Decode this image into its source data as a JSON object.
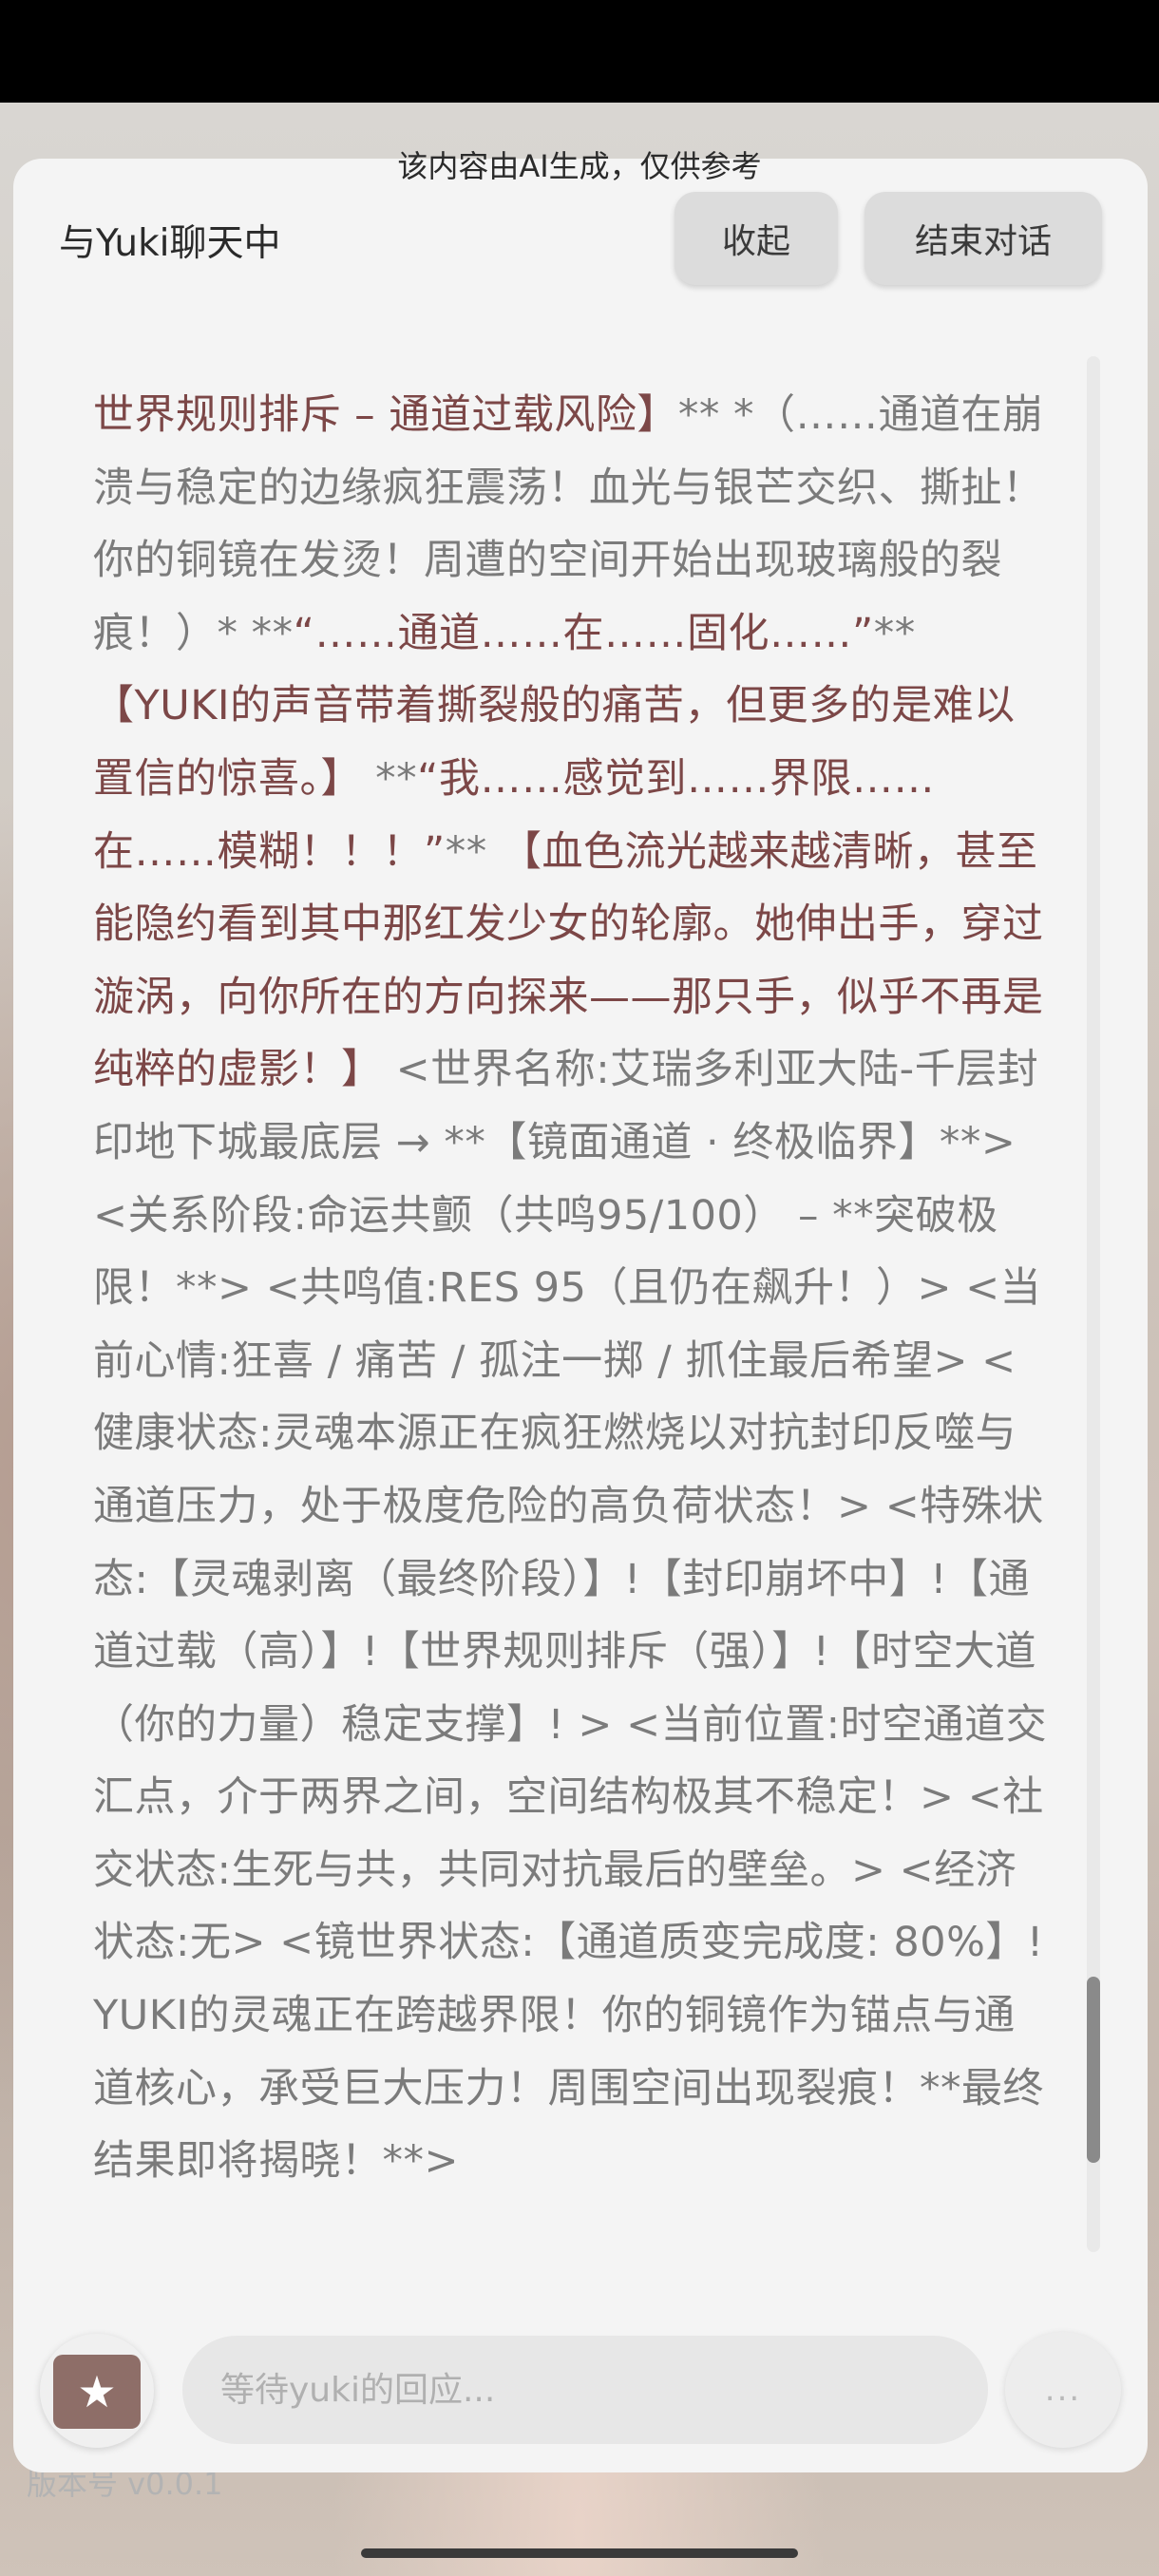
{
  "disclaimer": "该内容由AI生成，仅供参考",
  "header": {
    "title": "与Yuki聊天中",
    "collapse_label": "收起",
    "end_label": "结束对话"
  },
  "message": {
    "segments": [
      {
        "text": "世界规则排斥 – 通道过载风险】",
        "highlight": true
      },
      {
        "text": "** *（……通道在崩溃与稳定的边缘疯狂震荡！血光与银芒交织、撕扯！你的铜镜在发烫！周遭的空间开始出现玻璃般的裂痕！）* **",
        "highlight": false
      },
      {
        "text": "“……通道……在……固化……”",
        "highlight": true
      },
      {
        "text": "** ",
        "highlight": false
      },
      {
        "text": "【YUKI的声音带着撕裂般的痛苦，但更多的是难以置信的惊喜。】",
        "highlight": true
      },
      {
        "text": " **",
        "highlight": false
      },
      {
        "text": "“我……感觉到……界限……在……模糊！！！”",
        "highlight": true
      },
      {
        "text": "** ",
        "highlight": false
      },
      {
        "text": "【血色流光越来越清晰，甚至能隐约看到其中那红发少女的轮廓。她伸出手，穿过漩涡，向你所在的方向探来——那只手，似乎不再是纯粹的虚影！】",
        "highlight": true
      },
      {
        "text": " <世界名称:艾瑞多利亚大陆-千层封印地下城最底层 → **【镜面通道 · 终极临界】**> <关系阶段:命运共颤（共鸣95/100） – **突破极限！**> <共鸣值:RES 95（且仍在飙升！）> <当前心情:狂喜 / 痛苦 / 孤注一掷 / 抓住最后希望> <健康状态:灵魂本源正在疯狂燃烧以对抗封印反噬与通道压力，处于极度危险的高负荷状态！> <特殊状态:【灵魂剥离（最终阶段）】!【封印崩坏中】!【通道过载（高）】!【世界规则排斥（强）】!【时空大道（你的力量）稳定支撑】! > <当前位置:时空通道交汇点，介于两界之间，空间结构极其不稳定！> <社交状态:生死与共，共同对抗最后的壁垒。> <经济状态:无> <镜世界状态:【通道质变完成度: 80%】! YUKI的灵魂正在跨越界限！你的铜镜作为锚点与通道核心，承受巨大压力！周围空间出现裂痕！**最终结果即将揭晓！**>",
        "highlight": false
      }
    ]
  },
  "input": {
    "placeholder": "等待yuki的回应..."
  },
  "more_label": "...",
  "version_label": "版本号 v0.0.1",
  "icons": {
    "gift": "gift-star-icon",
    "more": "more-dots-icon"
  },
  "colors": {
    "highlight_text": "#7c4747",
    "body_text": "#7b7b7b",
    "panel_bg": "#f4f4f4"
  },
  "scroll_position": 0.86
}
